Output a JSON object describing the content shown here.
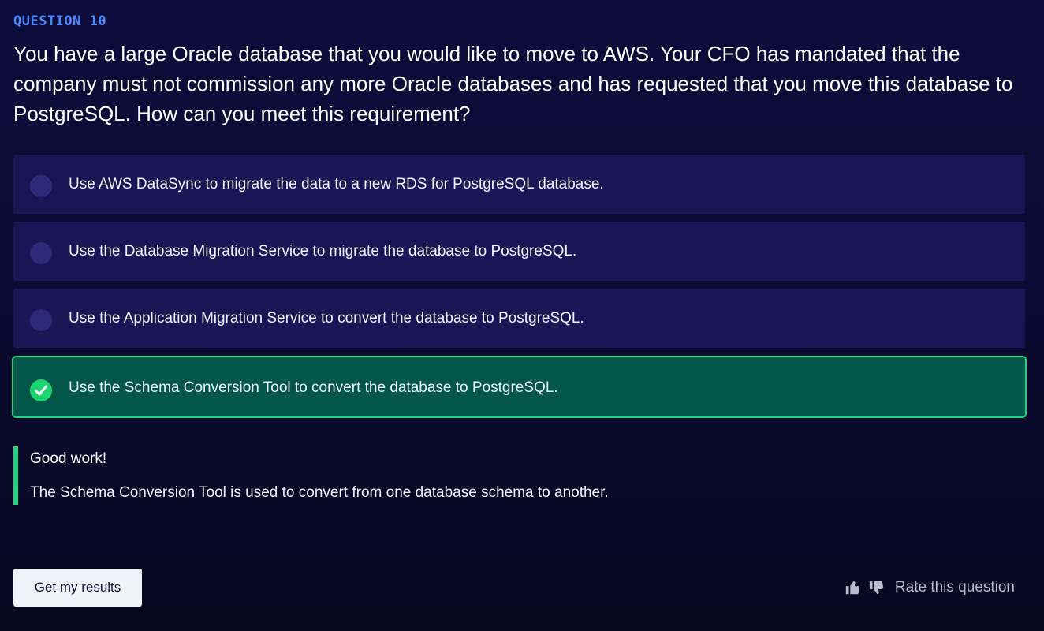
{
  "question": {
    "label": "QUESTION 10",
    "text": "You have a large Oracle database that you would like to move to AWS. Your CFO has mandated that the company must not commission any more Oracle databases and has requested that you move this database to PostgreSQL. How can you meet this requirement?"
  },
  "options": [
    {
      "label": "Use AWS DataSync to migrate the data to a new RDS for PostgreSQL database.",
      "state": "unselected"
    },
    {
      "label": "Use the Database Migration Service to migrate the database to PostgreSQL.",
      "state": "unselected"
    },
    {
      "label": "Use the Application Migration Service to convert the database to PostgreSQL.",
      "state": "unselected"
    },
    {
      "label": "Use the Schema Conversion Tool to convert the database to PostgreSQL.",
      "state": "correct"
    }
  ],
  "feedback": {
    "title": "Good work!",
    "text": "The Schema Conversion Tool is used to convert from one database schema to another."
  },
  "actions": {
    "results_button": "Get my results",
    "rate_label": "Rate this question"
  },
  "colors": {
    "background": "#0b0b33",
    "accent_blue": "#4a8cff",
    "option_bg": "#1a1655",
    "correct_bg": "#02574a",
    "correct_border": "#1fd47c"
  },
  "icons": {
    "radio": "radio-circle-icon",
    "check": "check-circle-icon",
    "thumbs_up": "thumbs-up-icon",
    "thumbs_down": "thumbs-down-icon"
  }
}
